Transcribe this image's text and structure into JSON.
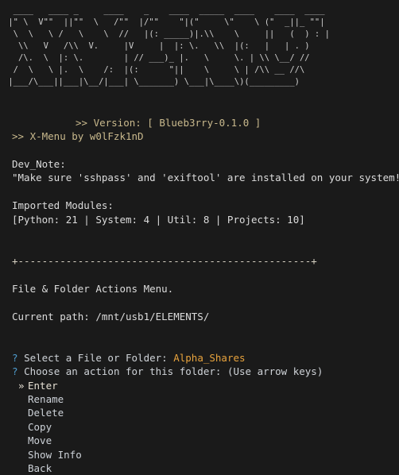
{
  "terminal": {
    "background_color": "#1a1a1a",
    "foreground_color": "#d8d8d8",
    "accent_tan": "#c9b98d",
    "accent_cyan": "#4f9dcf",
    "accent_orange": "#e8a33d",
    "selected_color": "#e6e0d4"
  },
  "banner": {
    "name": "x-menu-ascii-logo",
    "art": "  ____   ____ _     ____    _    ____  _____  ____    ____  ____\n |\" \\  V\"\"  ||\"\"  \\   /\"\"  |/\"\"    \"|(\"     \\\"    \\ (\"  _||_ \"\"|\n  \\  \\   \\ /   \\    \\  //   |(: _____)|.\\\\    \\     ||   (  ) : |\n   \\\\   V   /\\\\  V.     |V     |  |: \\.   \\\\  |(:   |   | . )\n   /\\.  \\  |: \\.        | // ___)_ |.   \\     \\. | \\\\ \\__/ //\n  /  \\   \\ |.  \\    /:  |(:      \"||    \\     \\ | /\\\\ __ //\\\n |___/\\___||___|\\__/|___| \\_______) \\___|\\____\\)(_________)"
  },
  "version": {
    "label": ">> Version: [ Blueb3rry-0.1.0 ]",
    "prefix": ">>",
    "key": "Version:",
    "value": "[ Blueb3rry-0.1.0 ]"
  },
  "author": {
    "line": ">> X-Menu by w0lFzk1nD",
    "prefix": ">>",
    "app_name": "X-Menu",
    "by": "by",
    "handle": "w0lFzk1nD"
  },
  "dev_note": {
    "label": "Dev_Note:",
    "text": "\"Make sure 'sshpass' and 'exiftool' are installed on your system!\""
  },
  "imported_modules": {
    "label": "Imported Modules:",
    "summary": "[Python: 21 | System: 4 | Util: 8 | Projects: 10]",
    "items": [
      {
        "name": "Python",
        "count": "21"
      },
      {
        "name": "System",
        "count": "4"
      },
      {
        "name": "Util",
        "count": "8"
      },
      {
        "name": "Projects",
        "count": "10"
      }
    ]
  },
  "separator": "+-------------------------------------------------+",
  "menu_header": {
    "title": "File & Folder Actions Menu.",
    "path_label": "Current path:",
    "path_value": "/mnt/usb1/ELEMENTS/",
    "path_line": "Current path: /mnt/usb1/ELEMENTS/"
  },
  "prompts": {
    "select": {
      "marker": "?",
      "label": "Select a File or Folder:",
      "value": "Alpha_Shares"
    },
    "action": {
      "marker": "?",
      "label": "Choose an action for this folder:",
      "hint": "(Use arrow keys)"
    }
  },
  "menu": {
    "pointer": "»",
    "selected_index": 0,
    "items": [
      {
        "label": "Enter",
        "selected": true
      },
      {
        "label": "Rename",
        "selected": false
      },
      {
        "label": "Delete",
        "selected": false
      },
      {
        "label": "Copy",
        "selected": false
      },
      {
        "label": "Move",
        "selected": false
      },
      {
        "label": "Show Info",
        "selected": false
      },
      {
        "label": "Back",
        "selected": false
      }
    ]
  }
}
